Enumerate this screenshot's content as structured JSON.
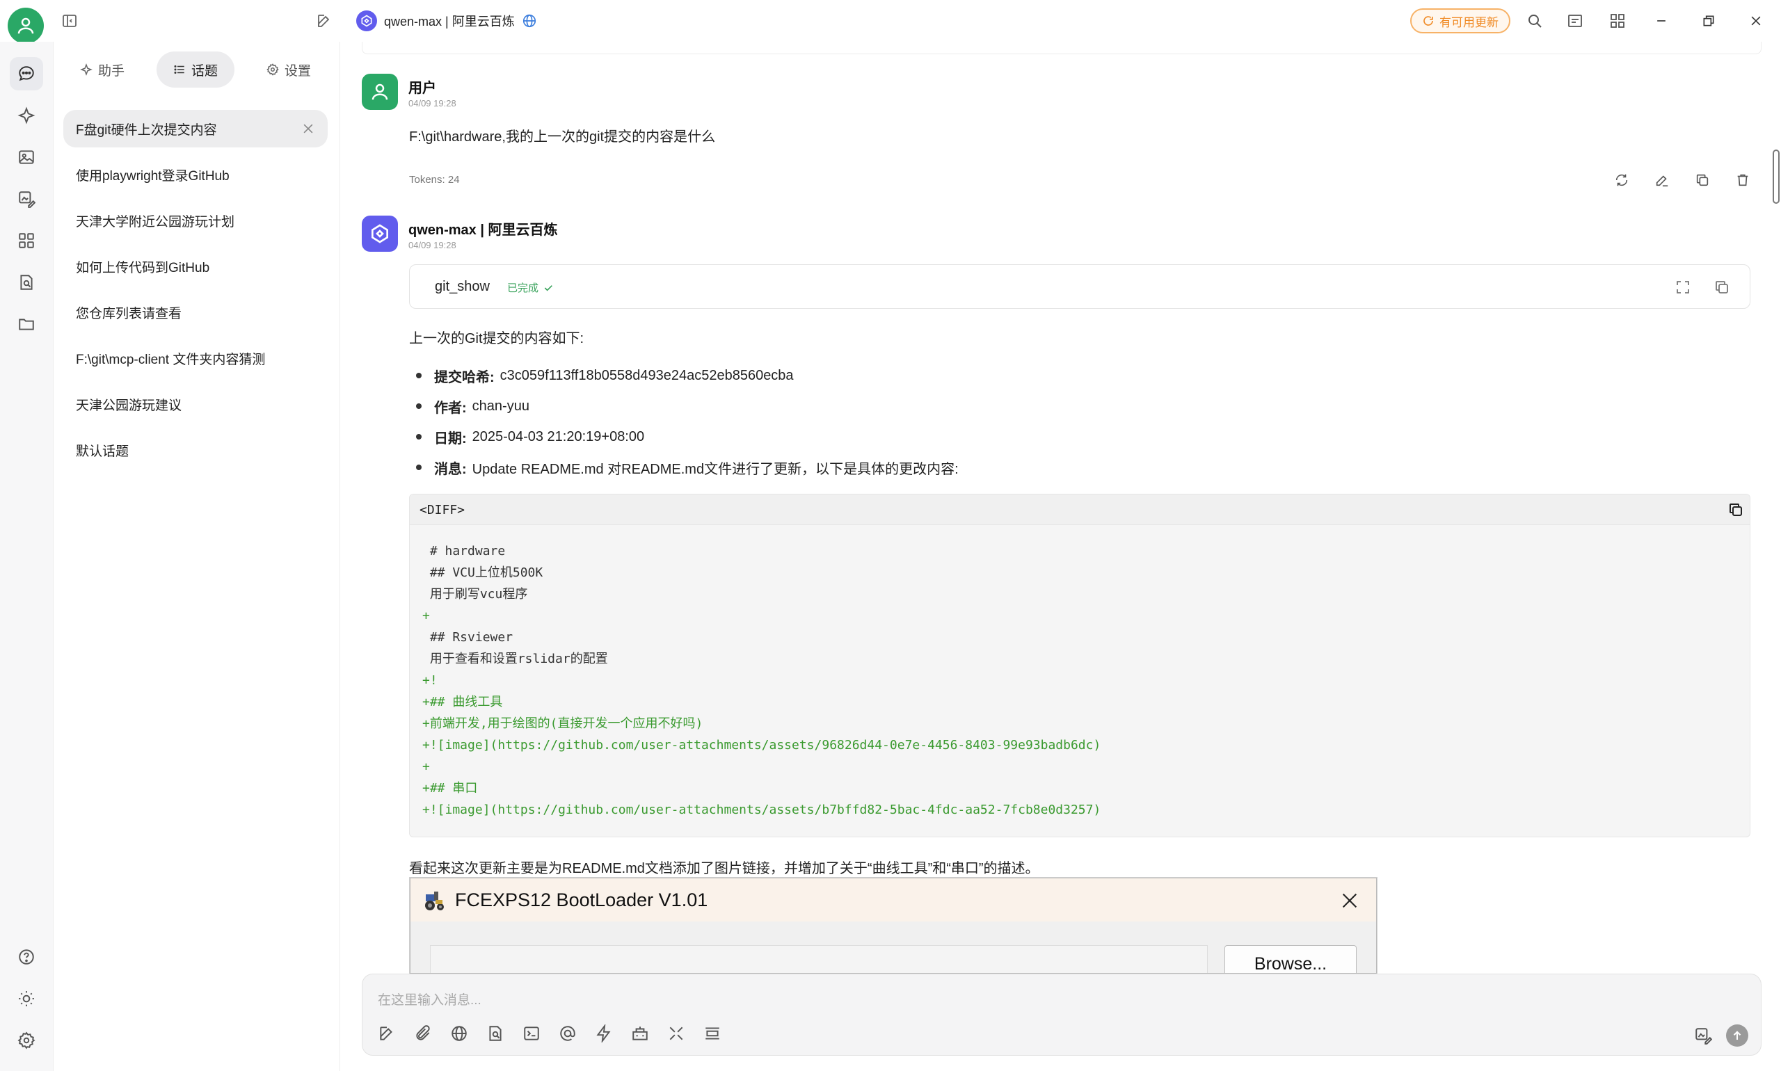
{
  "topbar": {
    "model_title": "qwen-max | 阿里云百炼",
    "update_label": "有可用更新",
    "colors": {
      "accent": "#2aa866",
      "update": "#f08a24",
      "model_logo": "#615ced"
    }
  },
  "sidepanel": {
    "tabs": [
      {
        "label": "助手",
        "icon": "sparkle-icon"
      },
      {
        "label": "话题",
        "icon": "list-icon"
      },
      {
        "label": "设置",
        "icon": "gear-icon"
      }
    ],
    "topics": [
      "F盘git硬件上次提交内容",
      "使用playwright登录GitHub",
      "天津大学附近公园游玩计划",
      "如何上传代码到GitHub",
      "您仓库列表请查看",
      "F:\\git\\mcp-client 文件夹内容猜测",
      "天津公园游玩建议",
      "默认话题"
    ]
  },
  "messages": {
    "user": {
      "name": "用户",
      "time": "04/09 19:28",
      "text": "F:\\git\\hardware,我的上一次的git提交的内容是什么",
      "tokens": "Tokens: 24"
    },
    "assistant": {
      "name": "qwen-max | 阿里云百炼",
      "time": "04/09 19:28",
      "tool": {
        "name": "git_show",
        "status": "已完成"
      },
      "intro": "上一次的Git提交的内容如下:",
      "bullets": [
        {
          "key": "提交哈希:",
          "value": " c3c059f113ff18b0558d493e24ac52eb8560ecba"
        },
        {
          "key": "作者:",
          "value": " chan-yuu"
        },
        {
          "key": "日期:",
          "value": " 2025-04-03 21:20:19+08:00"
        },
        {
          "key": "消息:",
          "value": " Update README.md 对README.md文件进行了更新，以下是具体的更改内容:"
        }
      ],
      "code_lang": "<DIFF>",
      "code_lines": [
        {
          "t": " # hardware",
          "c": "ctx"
        },
        {
          "t": " ## VCU上位机500K",
          "c": "ctx"
        },
        {
          "t": " 用于刷写vcu程序",
          "c": "ctx"
        },
        {
          "t": "+",
          "c": "add"
        },
        {
          "t": " ## Rsviewer",
          "c": "ctx"
        },
        {
          "t": " 用于查看和设置rslidar的配置",
          "c": "ctx"
        },
        {
          "t": "+!",
          "c": "add"
        },
        {
          "t": "+## 曲线工具",
          "c": "add"
        },
        {
          "t": "+前端开发,用于绘图的(直接开发一个应用不好吗)",
          "c": "add"
        },
        {
          "t": "+![image](https://github.com/user-attachments/assets/96826d44-0e7e-4456-8403-99e93badb6dc)",
          "c": "add"
        },
        {
          "t": "+",
          "c": "add"
        },
        {
          "t": "+## 串口",
          "c": "add"
        },
        {
          "t": "+![image](https://github.com/user-attachments/assets/b7bffd82-5bac-4fdc-aa52-7fcb8e0d3257)",
          "c": "add"
        }
      ],
      "summary": "看起来这次更新主要是为README.md文档添加了图片链接，并增加了关于“曲线工具”和“串口”的描述。"
    }
  },
  "bootloader": {
    "title": "FCEXPS12 BootLoader V1.01",
    "browse_label": "Browse..."
  },
  "composer": {
    "placeholder": "在这里输入消息..."
  }
}
